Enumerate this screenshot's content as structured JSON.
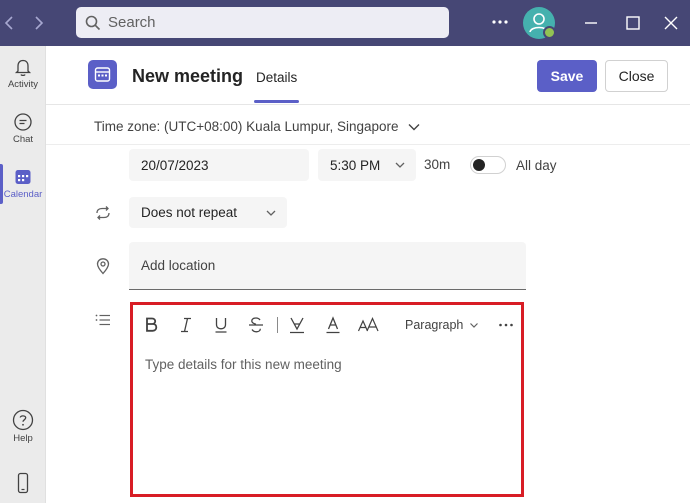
{
  "app": {
    "search_placeholder": "Search",
    "colors": {
      "titlebar": "#464775",
      "accent": "#5b5fc7",
      "highlight_border": "#d81d25",
      "presence": "#92c353"
    }
  },
  "rail": {
    "items": [
      {
        "label": "Activity",
        "icon": "bell-icon"
      },
      {
        "label": "Chat",
        "icon": "chat-icon"
      },
      {
        "label": "Calendar",
        "icon": "calendar-icon",
        "active": true
      },
      {
        "label": "Help",
        "icon": "help-icon"
      }
    ]
  },
  "header": {
    "title": "New meeting",
    "tab": "Details",
    "save_label": "Save",
    "close_label": "Close"
  },
  "form": {
    "timezone": "Time zone: (UTC+08:00) Kuala Lumpur, Singapore",
    "date": "20/07/2023",
    "time": "5:30 PM",
    "duration": "30m",
    "all_day_label": "All day",
    "all_day_on": false,
    "repeat": "Does not repeat",
    "location_placeholder": "Add location",
    "details_placeholder": "Type details for this new meeting",
    "paragraph_style": "Paragraph"
  }
}
